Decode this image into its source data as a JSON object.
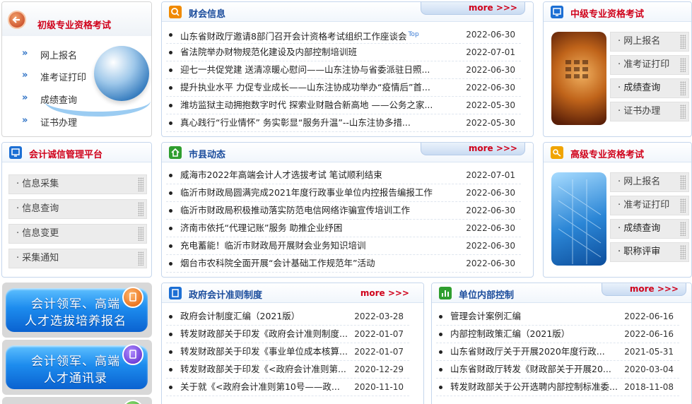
{
  "junior": {
    "title": "初级专业资格考试",
    "items": [
      "网上报名",
      "准考证打印",
      "成绩查询",
      "证书办理"
    ]
  },
  "caihui": {
    "title": "财会信息",
    "more": "more >>>",
    "items": [
      {
        "title": "山东省财政厅邀请8部门召开会计资格考试组织工作座谈会",
        "tag": "Top",
        "date": "2022-06-30"
      },
      {
        "title": "省法院举办财物规范化建设及内部控制培训班",
        "date": "2022-07-01"
      },
      {
        "title": "迎七一共促党建 送清凉暖心慰问——山东注协与省委派驻日照...",
        "date": "2022-06-30"
      },
      {
        "title": "提升执业水平 力促专业成长——山东注协成功举办“疫情后”首...",
        "date": "2022-06-30"
      },
      {
        "title": "潍坊监狱主动拥抱数字时代 探索业财融合新高地 ——公务之家...",
        "date": "2022-05-30"
      },
      {
        "title": "真心践行“行业情怀” 务实彰显“服务升温”--山东注协多措...",
        "date": "2022-05-30"
      }
    ]
  },
  "mid": {
    "title": "中级专业资格考试",
    "items": [
      "网上报名",
      "准考证打印",
      "成绩查询",
      "证书办理"
    ]
  },
  "credit": {
    "title": "会计诚信管理平台",
    "items": [
      "信息采集",
      "信息查询",
      "信息变更",
      "采集通知"
    ]
  },
  "county": {
    "title": "市县动态",
    "more": "more >>>",
    "items": [
      {
        "title": "威海市2022年高端会计人才选拔考试 笔试顺利结束",
        "date": "2022-07-01"
      },
      {
        "title": "临沂市财政局圆满完成2021年度行政事业单位内控报告编报工作",
        "date": "2022-06-30"
      },
      {
        "title": "临沂市财政局积极推动落实防范电信网络诈骗宣传培训工作",
        "date": "2022-06-30"
      },
      {
        "title": "济南市依托“代理记账”服务 助推企业纾困",
        "date": "2022-06-30"
      },
      {
        "title": "充电蓄能！临沂市财政局开展财会业务知识培训",
        "date": "2022-06-30"
      },
      {
        "title": "烟台市农科院全面开展“会计基础工作规范年”活动",
        "date": "2022-06-30"
      }
    ]
  },
  "senior": {
    "title": "高级专业资格考试",
    "items": [
      "网上报名",
      "准考证打印",
      "成绩查询",
      "职称评审"
    ]
  },
  "banners": [
    {
      "line1": "会计领军、高端",
      "line2": "人才选拔培养报名"
    },
    {
      "line1": "会计领军、高端",
      "line2": "人才通讯录"
    }
  ],
  "gov": {
    "title": "政府会计准则制度",
    "more": "more >>>",
    "items": [
      {
        "title": "政府会计制度汇编（2021版）",
        "date": "2022-03-28"
      },
      {
        "title": "转发财政部关于印发《政府会计准则制度...",
        "date": "2022-01-07"
      },
      {
        "title": "转发财政部关于印发《事业单位成本核算...",
        "date": "2022-01-07"
      },
      {
        "title": "转发财政部关于印发《<政府会计准则第...",
        "date": "2020-12-29"
      },
      {
        "title": "关于就《<政府会计准则第10号——政...",
        "date": "2020-11-10"
      }
    ]
  },
  "internal": {
    "title": "单位内部控制",
    "more": "more >>>",
    "items": [
      {
        "title": "管理会计案例汇编",
        "date": "2022-06-16"
      },
      {
        "title": "内部控制政策汇编（2021版）",
        "date": "2022-06-16"
      },
      {
        "title": "山东省财政厅关于开展2020年度行政...",
        "date": "2021-05-31"
      },
      {
        "title": "山东省财政厅转发《财政部关于开展20...",
        "date": "2020-03-04"
      },
      {
        "title": "转发财政部关于公开选聘内部控制标准委...",
        "date": "2018-11-08"
      }
    ]
  },
  "colors": {
    "accent_red": "#d0021b",
    "accent_blue": "#1a4c9c",
    "border": "#c5d6ec"
  }
}
